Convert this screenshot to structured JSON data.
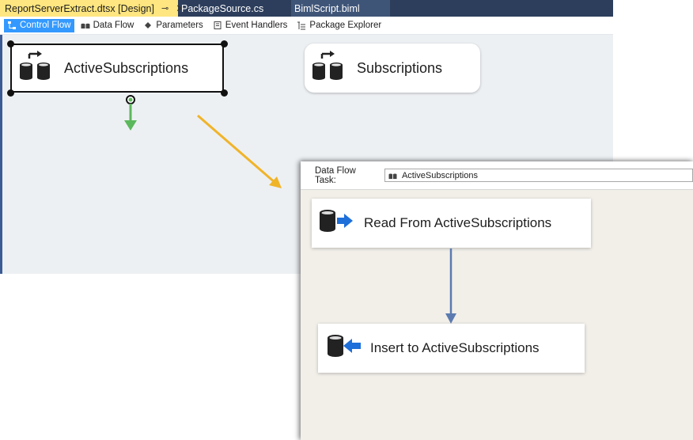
{
  "tabs": [
    {
      "label": "ReportServerExtract.dtsx [Design]",
      "pin": "⊸",
      "close": "✕"
    },
    {
      "label": "PackageSource.cs"
    },
    {
      "label": "BimlScript.biml"
    }
  ],
  "designer_tabs": [
    {
      "label": "Control Flow",
      "icon": "control-flow-icon"
    },
    {
      "label": "Data Flow",
      "icon": "data-flow-icon"
    },
    {
      "label": "Parameters",
      "icon": "parameters-icon"
    },
    {
      "label": "Event Handlers",
      "icon": "event-handlers-icon"
    },
    {
      "label": "Package Explorer",
      "icon": "package-explorer-icon"
    }
  ],
  "control_flow": {
    "tasks": [
      {
        "label": "ActiveSubscriptions",
        "icon": "data-flow-task-icon",
        "selected": true
      },
      {
        "label": "Subscriptions",
        "icon": "data-flow-task-icon",
        "selected": false
      }
    ]
  },
  "data_flow_panel": {
    "header_label": "Data Flow Task:",
    "selected_task": "ActiveSubscriptions",
    "components": [
      {
        "label": "Read From ActiveSubscriptions",
        "icon": "source-icon"
      },
      {
        "label": "Insert to ActiveSubscriptions",
        "icon": "destination-icon"
      }
    ]
  },
  "colors": {
    "tab_strip": "#2d3e5c",
    "active_tab": "#ffe680",
    "designer_tab_active": "#3399ff",
    "canvas": "#edf0f3",
    "precedence_arrow": "#5cb85c",
    "callout_arrow": "#f0b429",
    "data_path": "#5b7bb0",
    "data_flow_canvas": "#f2efe9"
  }
}
